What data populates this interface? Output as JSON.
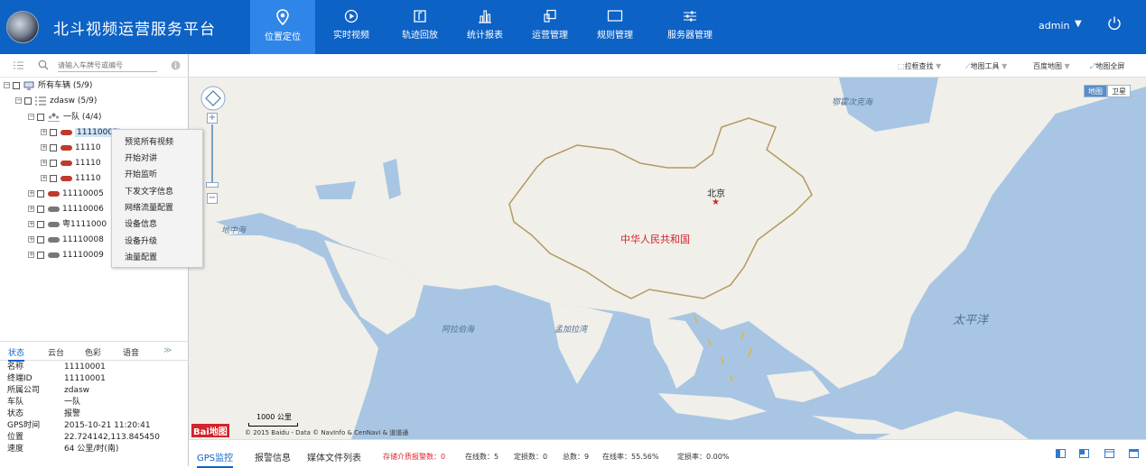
{
  "app": {
    "title": "北斗视频运营服务平台"
  },
  "nav": {
    "items": [
      {
        "label": "位置定位",
        "icon": "location-pin-icon",
        "active": true
      },
      {
        "label": "实时视频",
        "icon": "play-circle-icon",
        "active": false
      },
      {
        "label": "轨迹回放",
        "icon": "track-playback-icon",
        "active": false
      },
      {
        "label": "统计报表",
        "icon": "bar-chart-icon",
        "active": false
      },
      {
        "label": "运营管理",
        "icon": "operation-icon",
        "active": false
      },
      {
        "label": "规则管理",
        "icon": "monitor-icon",
        "active": false
      },
      {
        "label": "服务器管理",
        "icon": "sliders-icon",
        "active": false
      }
    ]
  },
  "user": {
    "name": "admin",
    "caret": "▼"
  },
  "search": {
    "placeholder": "请输入车牌号或编号"
  },
  "tree": {
    "root": "所有车辆 (5/9)",
    "company": "zdasw (5/9)",
    "team": "一队 (4/4)",
    "team_vehicles": [
      "11110001",
      "11110",
      "11110",
      "11110"
    ],
    "other_vehicles": [
      "11110005",
      "11110006",
      "粤1111000",
      "11110008",
      "11110009"
    ]
  },
  "context_menu": {
    "items": [
      "预览所有视频",
      "开始对讲",
      "开始监听",
      "下发文字信息",
      "网络流量配置",
      "设备信息",
      "设备升级",
      "油量配置"
    ]
  },
  "left_tabs": {
    "items": [
      "状态",
      "云台",
      "色彩",
      "语音"
    ],
    "collapse": "≫"
  },
  "status": {
    "rows": [
      {
        "k": "名称",
        "v": "11110001"
      },
      {
        "k": "终端ID",
        "v": "11110001"
      },
      {
        "k": "所属公司",
        "v": "zdasw"
      },
      {
        "k": "车队",
        "v": "一队"
      },
      {
        "k": "状态",
        "v": "报警"
      },
      {
        "k": "GPS时间",
        "v": "2015-10-21 11:20:41"
      },
      {
        "k": "位置",
        "v": "22.724142,113.845450"
      },
      {
        "k": "速度",
        "v": "64 公里/时(南)"
      }
    ]
  },
  "toolbar": {
    "box_search": "拉框查找",
    "map_tools": "地图工具",
    "baidu_map": "百度地图",
    "fullscreen": "地图全屏",
    "caret": "▼"
  },
  "map": {
    "type_map": "地图",
    "type_satellite": "卫星",
    "labels": {
      "china": "中华人民共和国",
      "beijing": "北京",
      "okhotsk": "鄂霍次克海",
      "med": "地中海",
      "arabian": "阿拉伯海",
      "bengal": "孟加拉湾",
      "pacific": "太平洋"
    },
    "scale": "1000 公里",
    "copyright": "© 2015 Baidu - Data © NavInfo & CenNavi & 道道通",
    "baidu_logo": "Bai地图"
  },
  "bottom": {
    "tabs": [
      "GPS监控",
      "报警信息",
      "媒体文件列表"
    ],
    "alarm": "存储介质报警数：0",
    "online": "在线数：5",
    "fixed": "定损数：0",
    "total": "总数：9",
    "online_rate": "在线率：55.56%",
    "fixed_rate": "定损率：0.00%"
  },
  "colors": {
    "brand": "#0d62c5",
    "active_nav": "#2f86e8",
    "sea": "#a8c6e3",
    "land": "#f1efe9",
    "alarm": "#e0242b"
  }
}
